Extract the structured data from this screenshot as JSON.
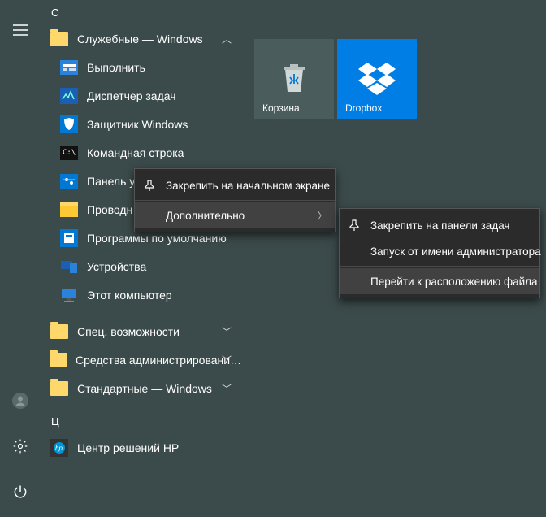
{
  "groups": {
    "c": "С",
    "ts": "Ц"
  },
  "folders": {
    "system_tools": "Служебные — Windows",
    "ease_of_access": "Спец. возможности",
    "admin_tools": "Средства администрировани…",
    "accessories": "Стандартные — Windows"
  },
  "apps": {
    "run": "Выполнить",
    "task_manager": "Диспетчер задач",
    "defender": "Защитник Windows",
    "cmd": "Командная строка",
    "control_panel": "Панель у",
    "explorer": "Проводн",
    "default_programs": "Программы по умолчанию",
    "devices": "Устройства",
    "this_pc": "Этот компьютер",
    "hp_center": "Центр решений HP"
  },
  "tiles": {
    "recycle": "Корзина",
    "dropbox": "Dropbox"
  },
  "ctx1": {
    "pin_start": "Закрепить на начальном экране",
    "more": "Дополнительно"
  },
  "ctx2": {
    "pin_taskbar": "Закрепить на панели задач",
    "run_admin": "Запуск от имени администратора",
    "open_location": "Перейти к расположению файла"
  },
  "colors": {
    "tile_recycle": "#4a5c5c",
    "tile_dropbox": "#007ee5"
  }
}
